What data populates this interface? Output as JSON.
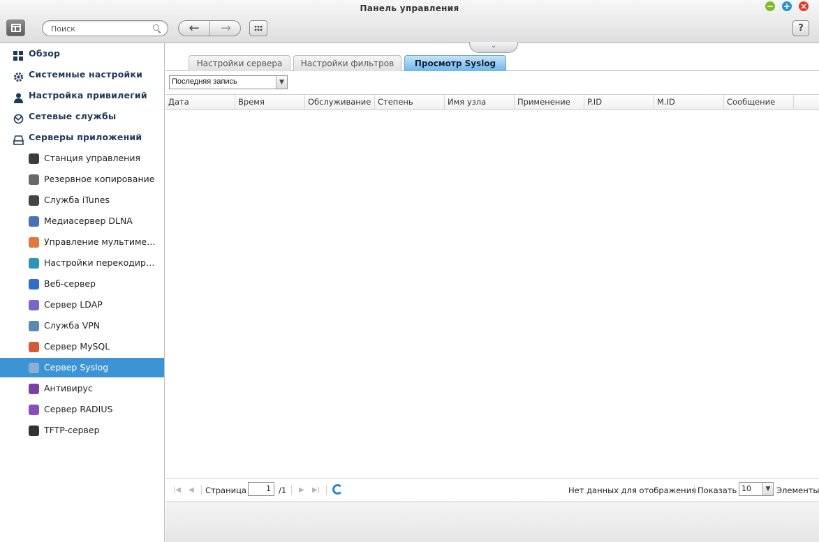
{
  "window": {
    "title": "Панель управления"
  },
  "toolbar": {
    "search_placeholder": "Поиск",
    "help_label": "?"
  },
  "sidebar": {
    "top_items": [
      {
        "label": "Обзор",
        "icon": "grid-icon"
      },
      {
        "label": "Системные настройки",
        "icon": "gear-icon"
      },
      {
        "label": "Настройка привилегий",
        "icon": "user-icon"
      },
      {
        "label": "Сетевые службы",
        "icon": "network-icon"
      },
      {
        "label": "Серверы приложений",
        "icon": "server-icon"
      }
    ],
    "sub_items": [
      {
        "label": "Станция управления",
        "icon": "station-icon",
        "color": "#3c3c3c"
      },
      {
        "label": "Резервное копирование",
        "icon": "backup-icon",
        "color": "#6a6a6a"
      },
      {
        "label": "Служба iTunes",
        "icon": "itunes-icon",
        "color": "#444444"
      },
      {
        "label": "Медиасервер DLNA",
        "icon": "dlna-icon",
        "color": "#4b6fb5"
      },
      {
        "label": "Управление мультимедиа",
        "icon": "multimedia-icon",
        "color": "#e2773c"
      },
      {
        "label": "Настройки перекодирования",
        "icon": "transcode-icon",
        "color": "#2a95b6"
      },
      {
        "label": "Веб-сервер",
        "icon": "web-server-icon",
        "color": "#2f6fc9"
      },
      {
        "label": "Сервер LDAP",
        "icon": "ldap-icon",
        "color": "#7a66c4"
      },
      {
        "label": "Служба VPN",
        "icon": "vpn-icon",
        "color": "#5f87b3"
      },
      {
        "label": "Сервер MySQL",
        "icon": "mysql-icon",
        "color": "#d35a3a"
      },
      {
        "label": "Сервер Syslog",
        "icon": "syslog-icon",
        "color": "#8ab0d8",
        "active": true
      },
      {
        "label": "Антивирус",
        "icon": "antivirus-icon",
        "color": "#7a3fa0"
      },
      {
        "label": "Сервер RADIUS",
        "icon": "radius-icon",
        "color": "#8a4fb8"
      },
      {
        "label": "TFTP-сервер",
        "icon": "tftp-icon",
        "color": "#333333"
      }
    ]
  },
  "tabs": [
    "Настройки сервера",
    "Настройки фильтров",
    "Просмотр Syslog"
  ],
  "active_tab": "Просмотр Syslog",
  "filter": {
    "value": "Последняя запись"
  },
  "columns": [
    "Дата",
    "Время",
    "Обслуживание",
    "Степень",
    "Имя узла",
    "Применение",
    "P.ID",
    "M.ID",
    "Сообщение"
  ],
  "pager": {
    "page_label": "Страница",
    "page_value": "1",
    "page_total": "/1",
    "empty_text": "Нет данных для отображения",
    "show_label": "Показать",
    "show_value": "10",
    "items_label": "Элементы"
  },
  "colors": {
    "accent": "#3d94d4",
    "active_tab": "#6eb7ea"
  }
}
